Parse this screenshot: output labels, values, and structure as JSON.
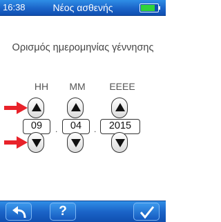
{
  "status_bar": {
    "time": "16:38",
    "title": "Νέος ασθενής",
    "battery_level": 0.85,
    "battery_color": "#2fd43a"
  },
  "screen": {
    "heading": "Ορισμός ημερομηνίας γέννησης"
  },
  "date_picker": {
    "day": {
      "header": "ΗΗ",
      "value": "09"
    },
    "month": {
      "header": "ΜΜ",
      "value": "04"
    },
    "year": {
      "header": "ΕΕΕΕ",
      "value": "2015"
    },
    "separator": "."
  },
  "bottom_bar": {
    "back_icon": "back-arrow-icon",
    "help_label": "?",
    "confirm_icon": "checkmark-icon"
  },
  "colors": {
    "bar_blue": "#1b64c8",
    "highlight_arrow": "#e8222a"
  }
}
